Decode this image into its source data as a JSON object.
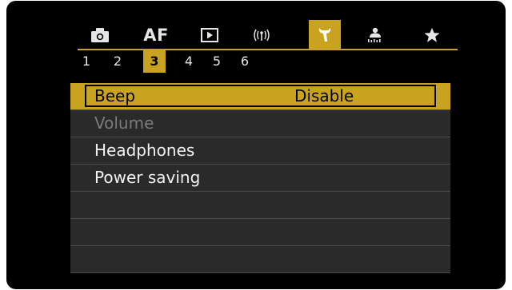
{
  "tabs": [
    {
      "name": "camera",
      "icon": "camera-icon"
    },
    {
      "name": "af",
      "label": "AF"
    },
    {
      "name": "playback",
      "icon": "playback-icon"
    },
    {
      "name": "wireless",
      "icon": "wireless-icon",
      "label": "((ψ))"
    },
    {
      "name": "setup",
      "icon": "wrench-icon",
      "active": true
    },
    {
      "name": "custom",
      "icon": "custom-function-icon"
    },
    {
      "name": "my-menu",
      "icon": "star-icon",
      "label": "★"
    }
  ],
  "pages": [
    "1",
    "2",
    "3",
    "4",
    "5",
    "6"
  ],
  "active_page": "3",
  "menu": {
    "items": [
      {
        "label": "Beep",
        "value": "Disable",
        "selected": true
      },
      {
        "label": "Volume",
        "value": "",
        "disabled": true
      },
      {
        "label": "Headphones",
        "value": ""
      },
      {
        "label": "Power saving",
        "value": ""
      },
      {
        "label": "",
        "value": ""
      },
      {
        "label": "",
        "value": ""
      },
      {
        "label": "",
        "value": ""
      }
    ]
  },
  "colors": {
    "accent": "#c9a21f",
    "background": "#000000",
    "row": "#2a2a2a",
    "text": "#f2f2f2",
    "disabled_text": "#7b7b7b"
  }
}
